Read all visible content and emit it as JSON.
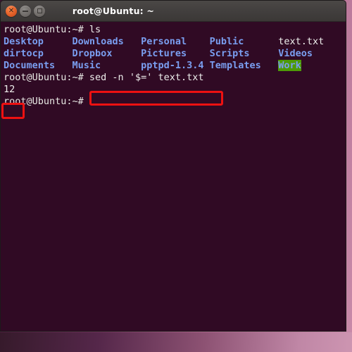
{
  "window": {
    "title": "root@Ubuntu: ~",
    "controls": [
      {
        "name": "close",
        "glyph": "✕"
      },
      {
        "name": "minimize",
        "glyph": "–"
      },
      {
        "name": "maximize",
        "glyph": "□"
      }
    ]
  },
  "terminal": {
    "prompt": "root@Ubuntu:~# ",
    "lines": [
      {
        "type": "command",
        "prompt": "root@Ubuntu:~# ",
        "command": "ls"
      },
      {
        "type": "listing",
        "cells": [
          {
            "text": "Desktop",
            "kind": "dir"
          },
          {
            "text": "Downloads",
            "kind": "dir"
          },
          {
            "text": "Personal",
            "kind": "dir"
          },
          {
            "text": "Public",
            "kind": "dir"
          },
          {
            "text": "text.txt",
            "kind": "file"
          }
        ]
      },
      {
        "type": "listing",
        "cells": [
          {
            "text": "dirtocp",
            "kind": "dir"
          },
          {
            "text": "Dropbox",
            "kind": "dir"
          },
          {
            "text": "Pictures",
            "kind": "dir"
          },
          {
            "text": "Scripts",
            "kind": "dir"
          },
          {
            "text": "Videos",
            "kind": "dir"
          }
        ]
      },
      {
        "type": "listing",
        "cells": [
          {
            "text": "Documents",
            "kind": "dir"
          },
          {
            "text": "Music",
            "kind": "dir"
          },
          {
            "text": "pptpd-1.3.4",
            "kind": "dir"
          },
          {
            "text": "Templates",
            "kind": "dir"
          },
          {
            "text": "Work",
            "kind": "work"
          }
        ]
      },
      {
        "type": "command",
        "prompt": "root@Ubuntu:~# ",
        "command": "sed -n '$=' text.txt"
      },
      {
        "type": "output",
        "text": "12"
      },
      {
        "type": "command",
        "prompt": "root@Ubuntu:~# ",
        "command": ""
      }
    ],
    "rows": {
      "row1": "root@Ubuntu:~# ls",
      "row2": "Desktop     Downloads   Personal    Public      text.txt",
      "row3": "dirtocp     Dropbox     Pictures    Scripts     Videos",
      "row4": "Documents   Music       pptpd-1.3.4 Templates   Work",
      "row5_prompt": "root@Ubuntu:~# ",
      "row5_cmd": "sed -n '$=' text.txt",
      "row6": "12",
      "row7": "root@Ubuntu:~# "
    }
  },
  "annotations": {
    "color": "#ee1111",
    "items": [
      {
        "name": "command-highlight",
        "target": "sed -n '$=' text.txt"
      },
      {
        "name": "output-highlight",
        "target": "12"
      }
    ]
  },
  "colors": {
    "terminal_background": "#300a24",
    "titlebar": "#423f3e",
    "directory_text": "#7a9ef0",
    "file_text": "#eeeeec",
    "work_highlight_bg": "#4e9a06",
    "annotation_red": "#ee1111",
    "close_button": "#e8642a"
  }
}
